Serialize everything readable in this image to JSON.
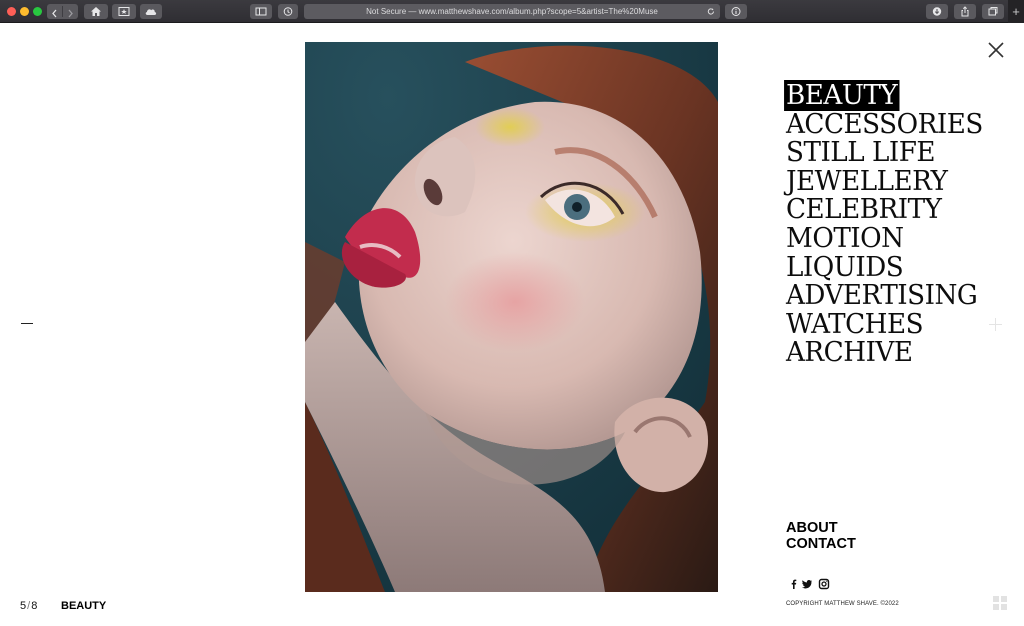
{
  "browser": {
    "url": "Not Secure — www.matthewshave.com/album.php?scope=5&artist=The%20Muse",
    "new_tab_symbol": "+"
  },
  "photo": {
    "alt": "Portrait of a red-haired woman looking upward with pink lips and yellow eyeshadow"
  },
  "menu": {
    "items": [
      {
        "label": "BEAUTY",
        "active": true
      },
      {
        "label": "ACCESSORIES",
        "active": false
      },
      {
        "label": "STILL LIFE",
        "active": false
      },
      {
        "label": "JEWELLERY",
        "active": false
      },
      {
        "label": "CELEBRITY",
        "active": false
      },
      {
        "label": "MOTION",
        "active": false
      },
      {
        "label": "LIQUIDS",
        "active": false
      },
      {
        "label": "ADVERTISING",
        "active": false
      },
      {
        "label": "WATCHES",
        "active": false
      },
      {
        "label": "ARCHIVE",
        "active": false
      }
    ]
  },
  "secondary": {
    "about": "ABOUT",
    "contact": "CONTACT"
  },
  "social": [
    "facebook-icon",
    "twitter-icon",
    "instagram-icon"
  ],
  "copyright": "COPYRIGHT MATTHEW SHAVE. ©2022",
  "gallery": {
    "current": "5",
    "separator": "/",
    "total": "8",
    "category": "BEAUTY"
  },
  "colors": {
    "accent_active_bg": "#000000",
    "chrome_bg": "#38373c",
    "photo_bg": "#1f4450"
  }
}
